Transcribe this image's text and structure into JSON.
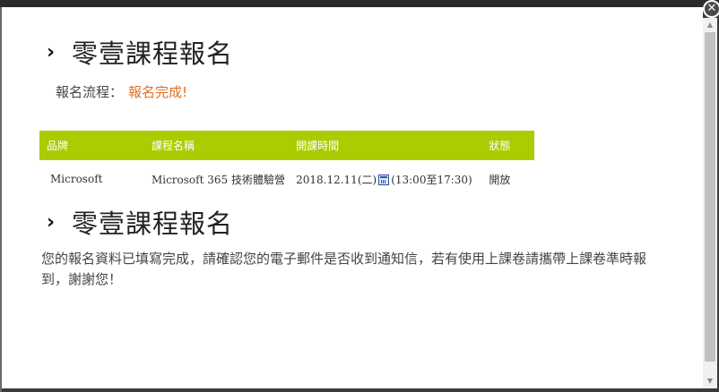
{
  "modal": {
    "close_label": "✕",
    "heading_top": "零壹課程報名",
    "flow_label": "報名流程：",
    "flow_value": "報名完成!",
    "table": {
      "headers": [
        "品牌",
        "課程名稱",
        "開課時間",
        "狀態"
      ],
      "rows": [
        {
          "brand": "Microsoft",
          "course": "Microsoft 365 技術體驗營",
          "date": "2018.12.11(二)",
          "time": "(13:00至17:30)",
          "status": "開放"
        }
      ]
    },
    "heading_bottom": "零壹課程報名",
    "message": "您的報名資料已填寫完成，請確認您的電子郵件是否收到通知信，若有使用上課卷請攜帶上課卷準時報到，謝謝您！"
  },
  "colors": {
    "table_header_bg": "#aacc00",
    "accent_orange": "#e0701e"
  },
  "icons": {
    "heading_chevron": "chevron-right-icon",
    "calendar": "calendar-icon",
    "close": "close-icon"
  }
}
